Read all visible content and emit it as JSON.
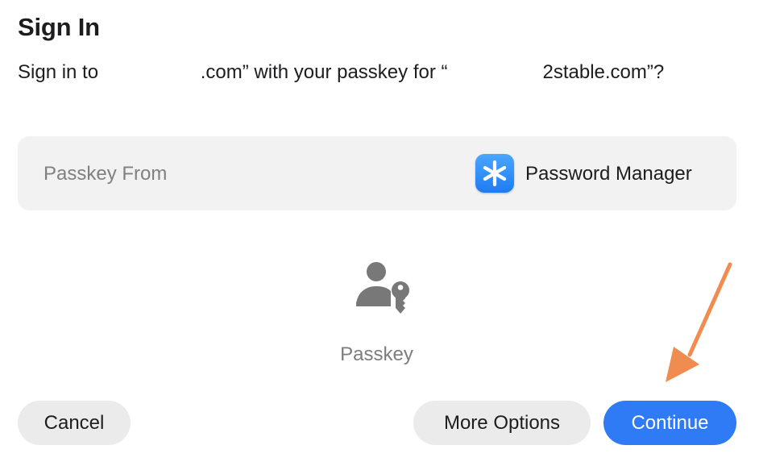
{
  "dialog": {
    "title": "Sign In",
    "message_prefix": "Sign in to ",
    "message_mid": ".com” with your passkey for “",
    "message_suffix": "2stable.com”?"
  },
  "passkey_source": {
    "label": "Passkey From",
    "app_name": "Password Manager",
    "app_icon": "asterisk-icon"
  },
  "credential": {
    "icon": "person-key-icon",
    "label": "Passkey"
  },
  "buttons": {
    "cancel": "Cancel",
    "more_options": "More Options",
    "continue": "Continue"
  },
  "colors": {
    "accent": "#2f7bf5",
    "annotation_arrow": "#f08c50"
  }
}
